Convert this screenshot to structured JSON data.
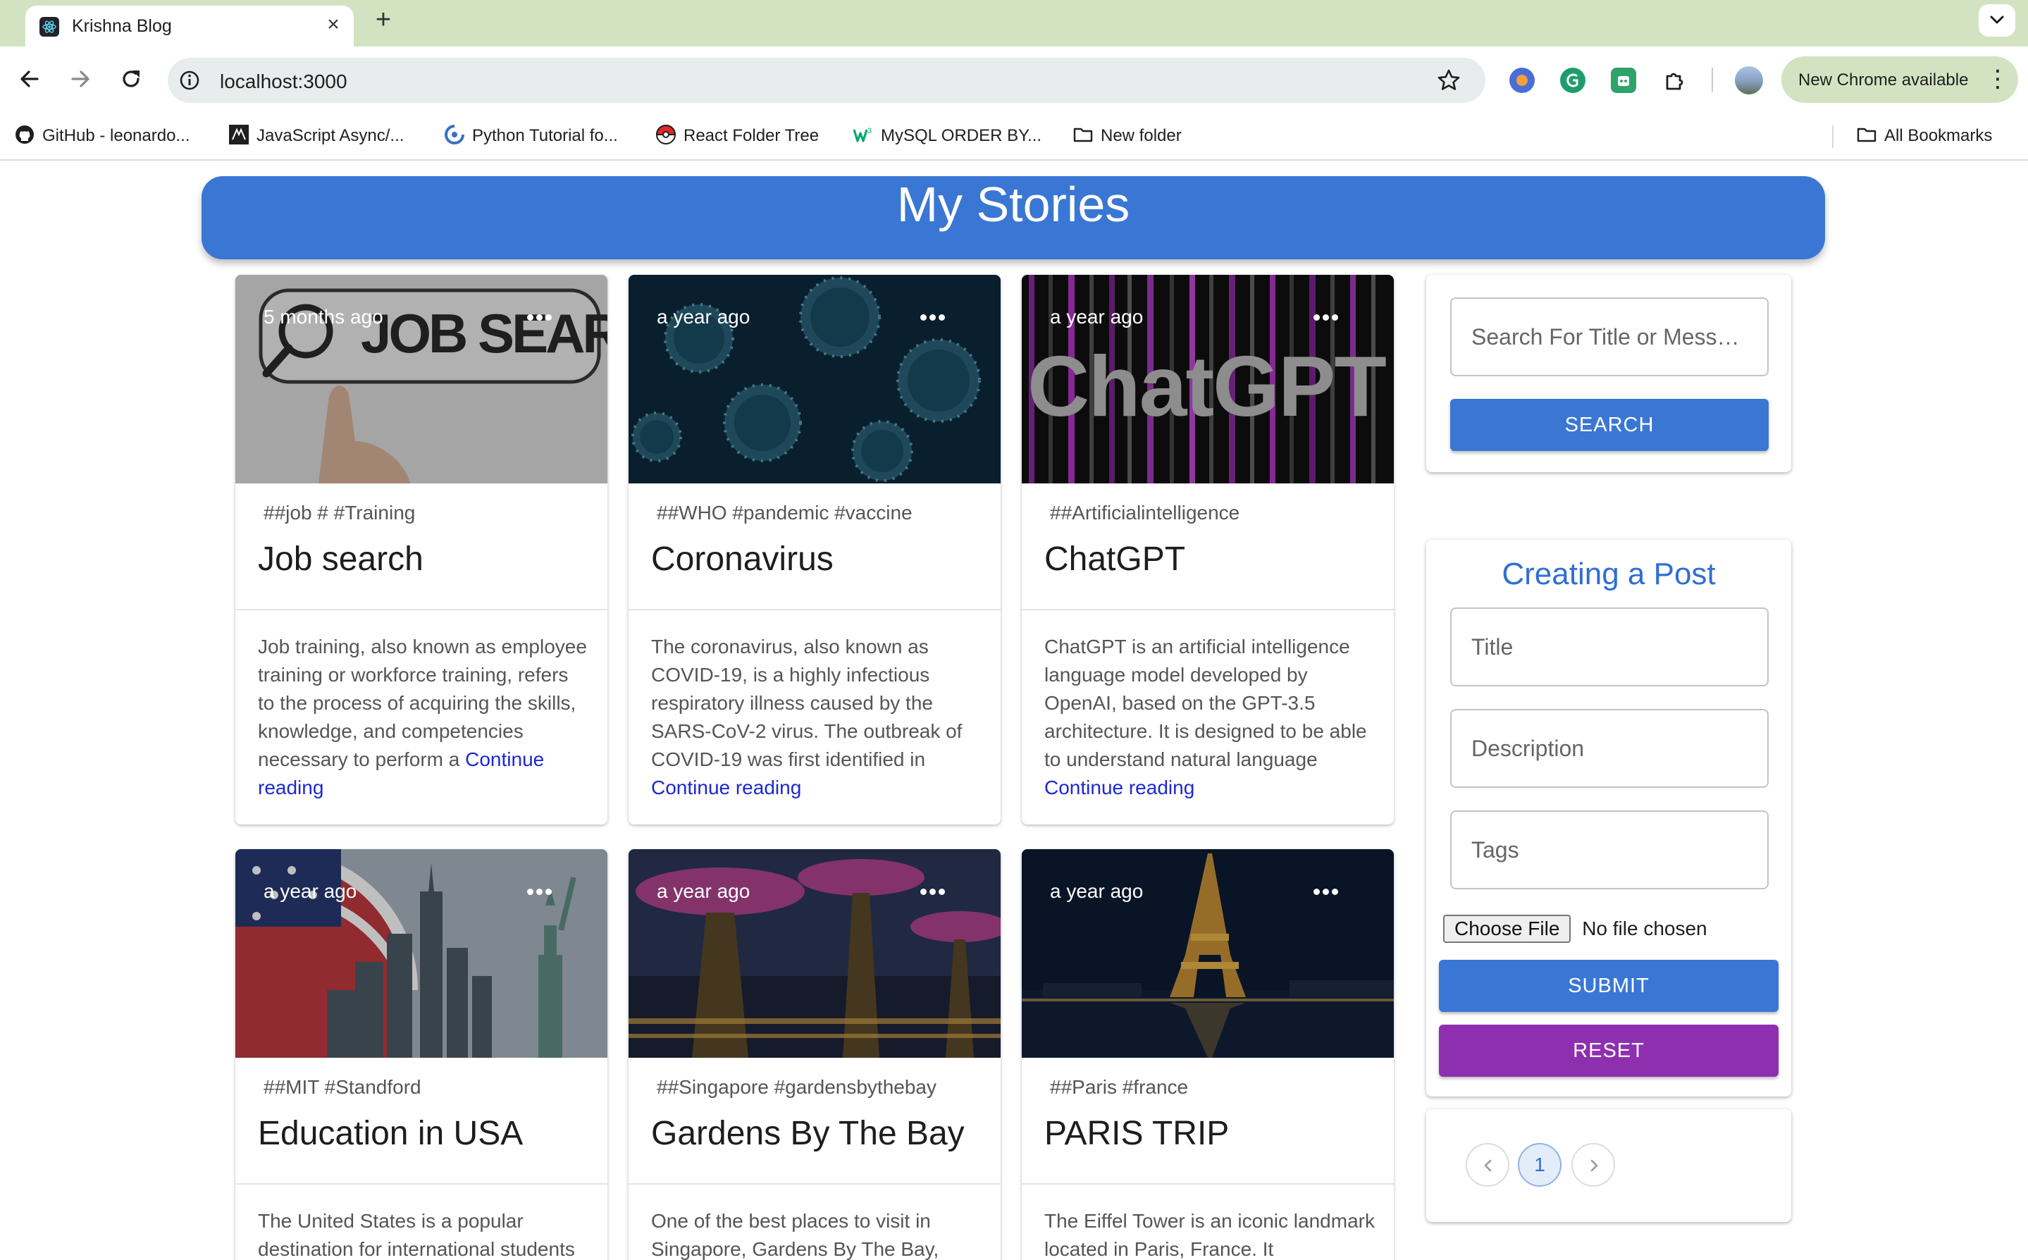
{
  "browser": {
    "tab_title": "Krishna Blog",
    "tab_close": "×",
    "new_tab": "+",
    "url": "localhost:3000",
    "update_label": "New Chrome available",
    "update_menu": "⋮",
    "bookmarks": [
      {
        "label": "GitHub - leonardo...",
        "icon": "github-icon"
      },
      {
        "label": "JavaScript Async/...",
        "icon": "javascript-site-icon"
      },
      {
        "label": "Python Tutorial fo...",
        "icon": "python-site-icon"
      },
      {
        "label": "React Folder Tree",
        "icon": "pokeball-icon"
      },
      {
        "label": "MySQL ORDER BY...",
        "icon": "w3schools-icon"
      },
      {
        "label": "New folder",
        "icon": "folder-icon"
      }
    ],
    "all_bookmarks": "All Bookmarks"
  },
  "header": {
    "title": "My Stories"
  },
  "posts": [
    {
      "time": "5 months ago",
      "tags": "##job # #Training",
      "title": "Job search",
      "excerpt": "Job training, also known as employee training or workforce training, refers to the process of acquiring the skills, knowledge, and competencies necessary to perform a",
      "continue": "Continue reading",
      "image": "job-search-image",
      "image_text": "JOB SEARCH"
    },
    {
      "time": "a year ago",
      "tags": "##WHO #pandemic #vaccine",
      "title": "Coronavirus",
      "excerpt": "The coronavirus, also known as COVID-19, is a highly infectious respiratory illness caused by the SARS-CoV-2 virus. The outbreak of COVID-19 was first identified in",
      "continue": "Continue reading",
      "image": "virus-image"
    },
    {
      "time": "a year ago",
      "tags": "##Artificialintelligence",
      "title": "ChatGPT",
      "excerpt": "ChatGPT is an artificial intelligence language model developed by OpenAI, based on the GPT-3.5 architecture. It is designed to be able to understand natural language",
      "continue": "Continue reading",
      "image": "chatgpt-image",
      "image_text": "ChatGPT"
    },
    {
      "time": "a year ago",
      "tags": "##MIT #Standford",
      "title": "Education in USA",
      "excerpt": "The United States is a popular destination for international students",
      "image": "new-york-skyline-image"
    },
    {
      "time": "a year ago",
      "tags": "##Singapore #gardensbythebay",
      "title": "Gardens By The Bay",
      "excerpt": "One of the best places to visit in Singapore, Gardens By The Bay,",
      "image": "supertree-grove-image"
    },
    {
      "time": "a year ago",
      "tags": "##Paris #france",
      "title": "PARIS TRIP",
      "excerpt": "The Eiffel Tower is an iconic landmark located in Paris, France. It",
      "image": "eiffel-tower-image"
    }
  ],
  "search": {
    "placeholder": "Search For Title or Mess…",
    "button": "SEARCH"
  },
  "form": {
    "heading": "Creating a Post",
    "title_placeholder": "Title",
    "description_placeholder": "Description",
    "tags_placeholder": "Tags",
    "file_button": "Choose File",
    "file_status": "No file chosen",
    "submit": "SUBMIT",
    "reset": "RESET"
  },
  "pagination": {
    "current_page": "1"
  },
  "colors": {
    "primary": "#3a77d4",
    "secondary": "#8e2fb0",
    "link": "#1c28d2",
    "chrome_accent": "#d3e3c2"
  }
}
